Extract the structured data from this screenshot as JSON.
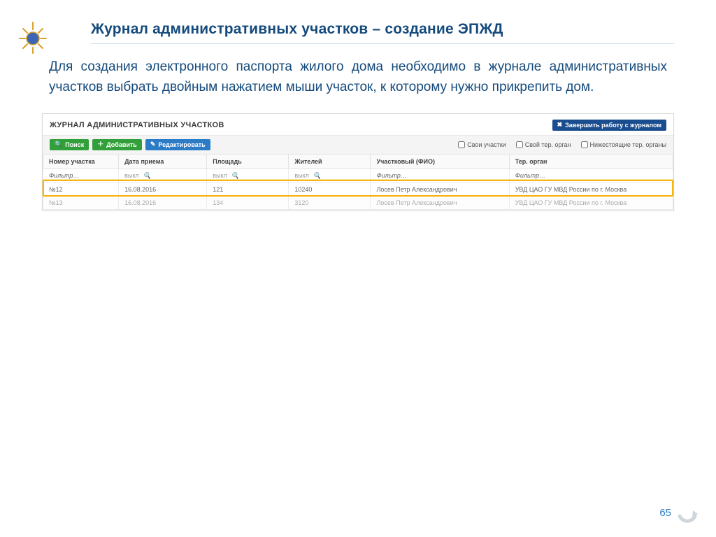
{
  "page": {
    "title": "Журнал административных участков – создание ЭПЖД",
    "intro": "Для создания электронного паспорта жилого дома необходимо в журнале административных участков выбрать двойным нажатием мыши участок, к которому нужно прикрепить дом.",
    "number": "65"
  },
  "app": {
    "title": "ЖУРНАЛ АДМИНИСТРАТИВНЫХ УЧАСТКОВ",
    "close_button": "Завершить работу с журналом",
    "toolbar": {
      "search": "Поиск",
      "add": "Добавить",
      "edit": "Редактировать"
    },
    "checkboxes": {
      "own_sections": "Свои участки",
      "own_org": "Свой тер. орган",
      "lower_orgs": "Нижестоящие тер. органы"
    },
    "columns": {
      "number": "Номер участка",
      "date": "Дата приема",
      "area": "Площадь",
      "residents": "Жителей",
      "officer": "Участковый (ФИО)",
      "org": "Тер. орган"
    },
    "filter_placeholder": "Фильтр…",
    "filter_off": "выкл",
    "rows": [
      {
        "number": "№12",
        "date": "16.08.2016",
        "area": "121",
        "residents": "10240",
        "officer": "Лосев Петр Александрович",
        "org": "УВД ЦАО ГУ МВД России по г. Москва"
      },
      {
        "number": "№13",
        "date": "16.08.2016",
        "area": "134",
        "residents": "3120",
        "officer": "Лосев Петр Александрович",
        "org": "УВД ЦАО ГУ МВД России по г. Москва"
      }
    ]
  }
}
